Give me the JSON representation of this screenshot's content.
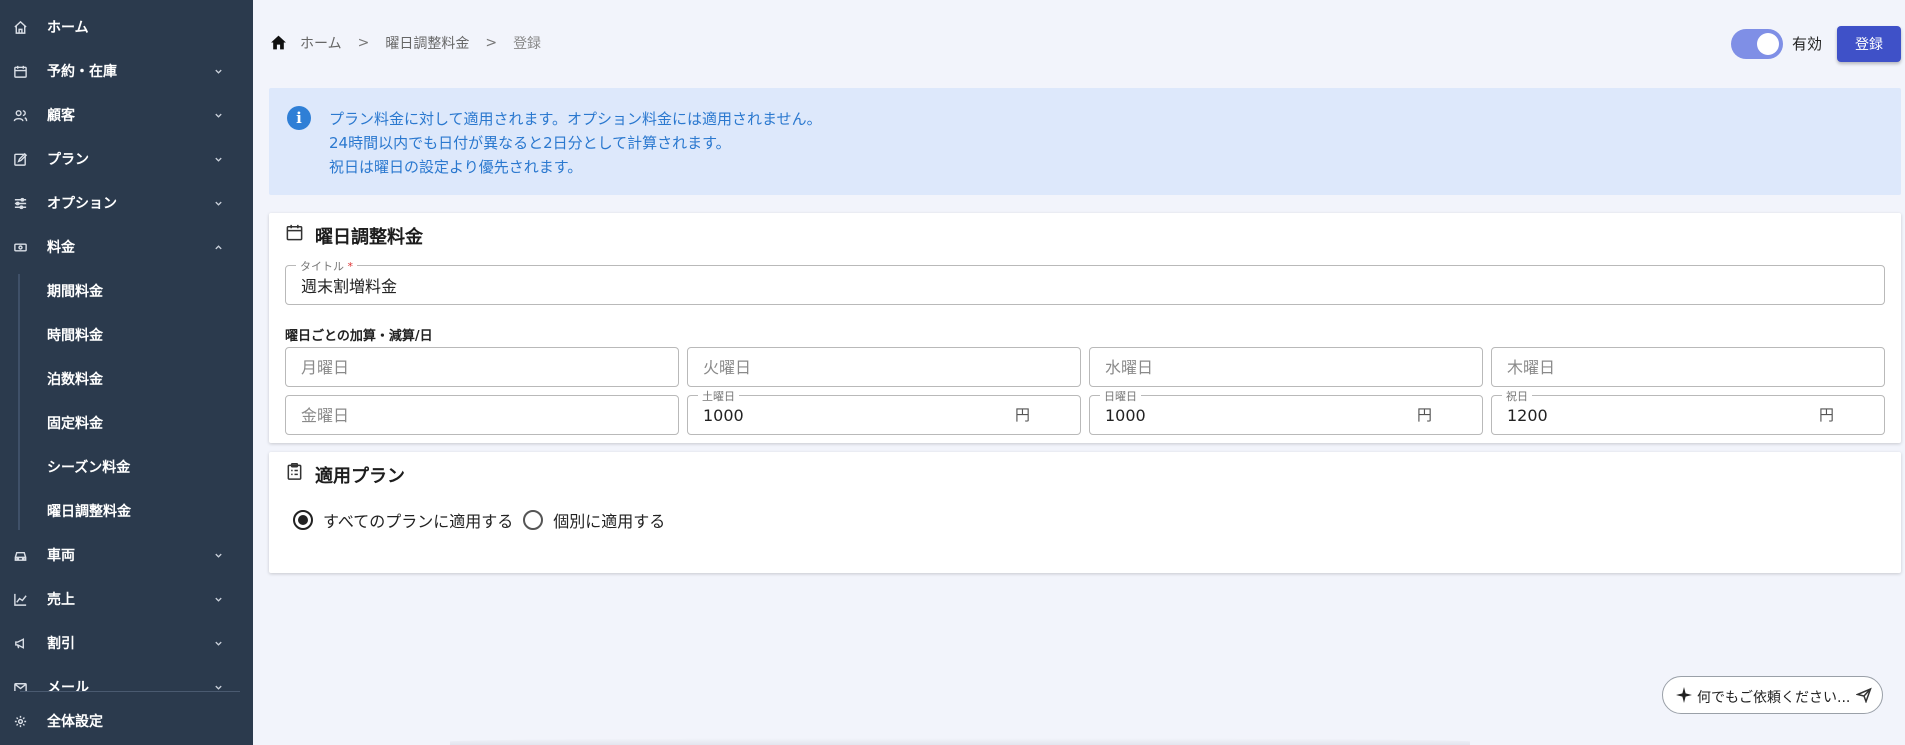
{
  "sidebar": {
    "items": [
      {
        "label": "ホーム",
        "icon": "home-icon",
        "expandable": false
      },
      {
        "label": "予約・在庫",
        "icon": "calendar-icon",
        "expandable": true
      },
      {
        "label": "顧客",
        "icon": "users-icon",
        "expandable": true
      },
      {
        "label": "プラン",
        "icon": "edit-document-icon",
        "expandable": true
      },
      {
        "label": "オプション",
        "icon": "sliders-icon",
        "expandable": true
      },
      {
        "label": "料金",
        "icon": "money-icon",
        "expandable": true,
        "expanded": true
      }
    ],
    "sub_items": [
      "期間料金",
      "時間料金",
      "泊数料金",
      "固定料金",
      "シーズン料金",
      "曜日調整料金"
    ],
    "items_after": [
      {
        "label": "車両",
        "icon": "car-icon",
        "expandable": true
      },
      {
        "label": "売上",
        "icon": "chart-icon",
        "expandable": true
      },
      {
        "label": "割引",
        "icon": "megaphone-icon",
        "expandable": true
      },
      {
        "label": "メール",
        "icon": "mail-icon",
        "expandable": true
      }
    ],
    "settings": {
      "label": "全体設定",
      "icon": "gear-icon"
    }
  },
  "breadcrumb": {
    "items": [
      "ホーム",
      "曜日調整料金",
      "登録"
    ],
    "separator": ">"
  },
  "header": {
    "toggle_label": "有効",
    "toggle_on": true,
    "register_label": "登録",
    "accent_color": "#3f51c8"
  },
  "info": {
    "lines": [
      "プラン料金に対して適用されます。オプション料金には適用されません。",
      "24時間以内でも日付が異なると2日分として計算されます。",
      "祝日は曜日の設定より優先されます。"
    ],
    "icon": "info-icon"
  },
  "weekday_card": {
    "title": "曜日調整料金",
    "title_field": {
      "label": "タイトル",
      "required_mark": "*",
      "value": "週末割増料金"
    },
    "section_label": "曜日ごとの加算・減算/日",
    "currency_unit": "円",
    "days": {
      "mon": {
        "placeholder": "月曜日",
        "value": ""
      },
      "tue": {
        "placeholder": "火曜日",
        "value": ""
      },
      "wed": {
        "placeholder": "水曜日",
        "value": ""
      },
      "thu": {
        "placeholder": "木曜日",
        "value": ""
      },
      "fri": {
        "placeholder": "金曜日",
        "value": ""
      },
      "sat": {
        "label": "土曜日",
        "value": "1000"
      },
      "sun": {
        "label": "日曜日",
        "value": "1000"
      },
      "hol": {
        "label": "祝日",
        "value": "1200"
      }
    }
  },
  "plan_card": {
    "title": "適用プラン",
    "options": [
      {
        "label": "すべてのプランに適用する",
        "selected": true
      },
      {
        "label": "個別に適用する",
        "selected": false
      }
    ]
  },
  "assistant": {
    "placeholder": "何でもご依頼ください..."
  }
}
